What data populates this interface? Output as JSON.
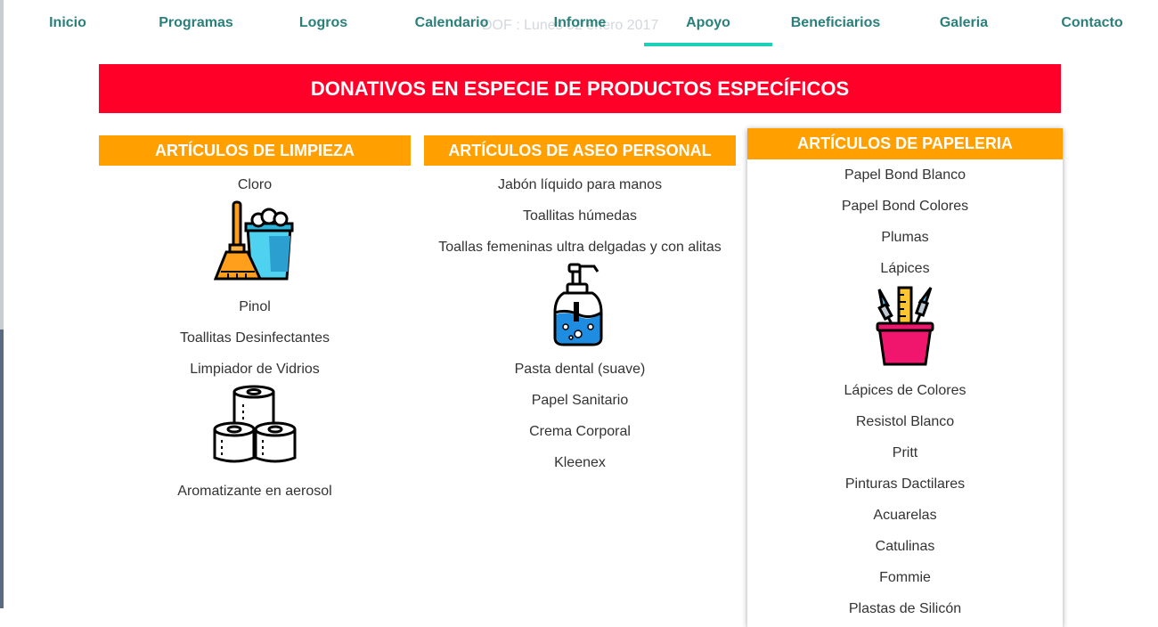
{
  "nav": {
    "ghost_text": "DOF : Lunes 02 enero 2017",
    "items": [
      "Inicio",
      "Programas",
      "Logros",
      "Calendario",
      "Informe",
      "Apoyo",
      "Beneficiarios",
      "Galeria",
      "Contacto"
    ],
    "active": "Apoyo",
    "link_color": "#2a7f7a",
    "underline_color": "#1fd0b8"
  },
  "banner": {
    "title": "DONATIVOS EN ESPECIE DE PRODUCTOS ESPECÍFICOS",
    "color": "#ff0029"
  },
  "columns": {
    "limpieza": {
      "title": "ARTÍCULOS DE LIMPIEZA",
      "items": [
        "Cloro",
        "Pinol",
        "Toallitas Desinfectantes",
        "Limpiador de Vidrios",
        "Aromatizante en aerosol"
      ],
      "icons": [
        "cleaning-bucket-broom-icon",
        "toilet-paper-rolls-icon"
      ]
    },
    "aseo": {
      "title": "ARTÍCULOS DE ASEO PERSONAL",
      "items": [
        "Jabón líquido para manos",
        "Toallitas húmedas",
        "Toallas femeninas ultra delgadas y con alitas",
        "Pasta dental (suave)",
        "Papel Sanitario",
        "Crema Corporal",
        "Kleenex"
      ],
      "icons": [
        "soap-dispenser-icon"
      ]
    },
    "papeleria": {
      "title": "ARTÍCULOS DE PAPELERIA",
      "items": [
        "Papel Bond Blanco",
        "Papel Bond Colores",
        "Plumas",
        "Lápices",
        "Lápices de Colores",
        "Resistol Blanco",
        "Pritt",
        "Pinturas Dactilares",
        "Acuarelas",
        "Catulinas",
        "Fommie",
        "Plastas de Silicón"
      ],
      "icons": [
        "pencil-cup-icon"
      ]
    },
    "header_color": "#ff9f00"
  }
}
